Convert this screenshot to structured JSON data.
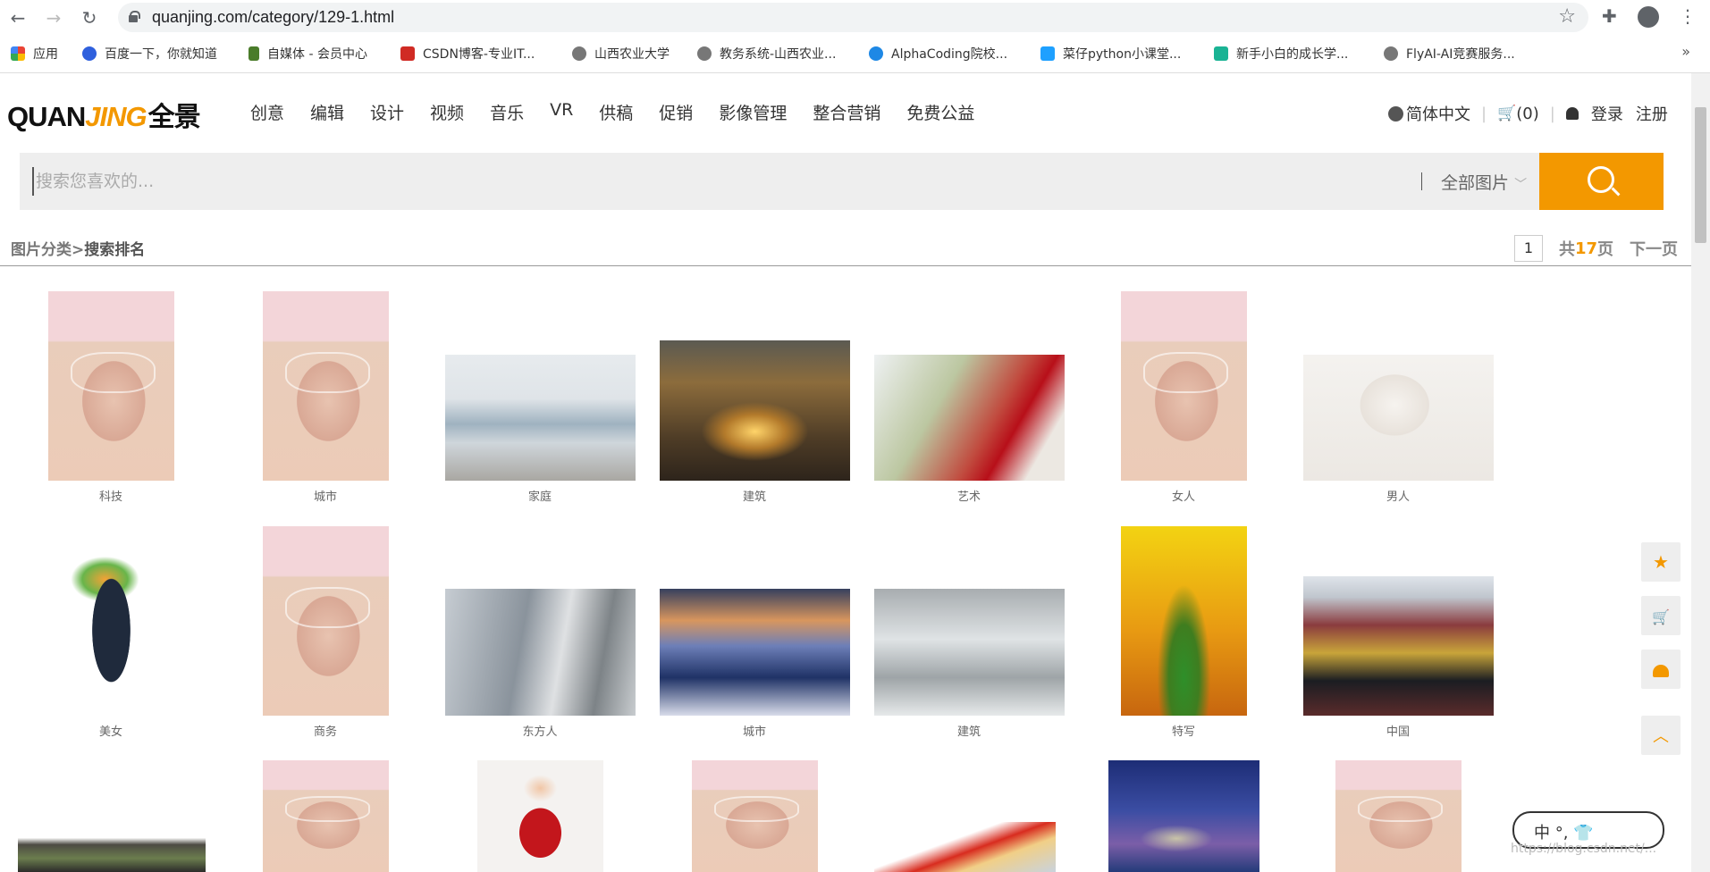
{
  "browser": {
    "url": "quanjing.com/category/129-1.html",
    "bookmarks": [
      {
        "label": "应用",
        "color": "#4285f4"
      },
      {
        "label": "百度一下，你就知道",
        "color": "#2f60dd"
      },
      {
        "label": "自媒体 - 会员中心",
        "color": "#4a7c2a"
      },
      {
        "label": "CSDN博客-专业IT...",
        "color": "#d02b24"
      },
      {
        "label": "山西农业大学",
        "color": "#777777"
      },
      {
        "label": "教务系统-山西农业...",
        "color": "#777777"
      },
      {
        "label": "AlphaCoding院校...",
        "color": "#1e88e5"
      },
      {
        "label": "菜仔python小课堂...",
        "color": "#1ea0ff"
      },
      {
        "label": "新手小白的成长学...",
        "color": "#1ab394"
      },
      {
        "label": "FlyAI-AI竞赛服务...",
        "color": "#777777"
      }
    ],
    "more": "»"
  },
  "site": {
    "logo_a": "QUAN",
    "logo_b": "JING",
    "logo_c": "全景",
    "nav": [
      "创意",
      "编辑",
      "设计",
      "视频",
      "音乐",
      "VR",
      "供稿",
      "促销",
      "影像管理",
      "整合营销",
      "免费公益"
    ],
    "language": "简体中文",
    "cart": "(0)",
    "login": "登录",
    "register": "注册",
    "accent": "#f39800"
  },
  "search": {
    "placeholder": "搜索您喜欢的...",
    "category": "全部图片"
  },
  "breadcrumb": {
    "root": "图片分类",
    "sep": ">",
    "current": "搜索排名"
  },
  "pager": {
    "page": "1",
    "total_prefix": "共",
    "total": "17",
    "total_suffix": "页",
    "next": "下一页"
  },
  "grid": [
    {
      "caption": "科技",
      "style": "face"
    },
    {
      "caption": "城市",
      "style": "face"
    },
    {
      "caption": "家庭",
      "style": "beach"
    },
    {
      "caption": "建筑",
      "style": "hagia"
    },
    {
      "caption": "艺术",
      "style": "gallery"
    },
    {
      "caption": "女人",
      "style": "face"
    },
    {
      "caption": "男人",
      "style": "woman-mask"
    },
    {
      "caption": "美女",
      "style": "shopper"
    },
    {
      "caption": "商务",
      "style": "face"
    },
    {
      "caption": "东方人",
      "style": "street"
    },
    {
      "caption": "城市",
      "style": "santorini"
    },
    {
      "caption": "建筑",
      "style": "hall"
    },
    {
      "caption": "特写",
      "style": "leaf"
    },
    {
      "caption": "中国",
      "style": "chinese"
    }
  ],
  "ime": "中 °, 👕",
  "watermark": "https://blog.csdn.net/..."
}
